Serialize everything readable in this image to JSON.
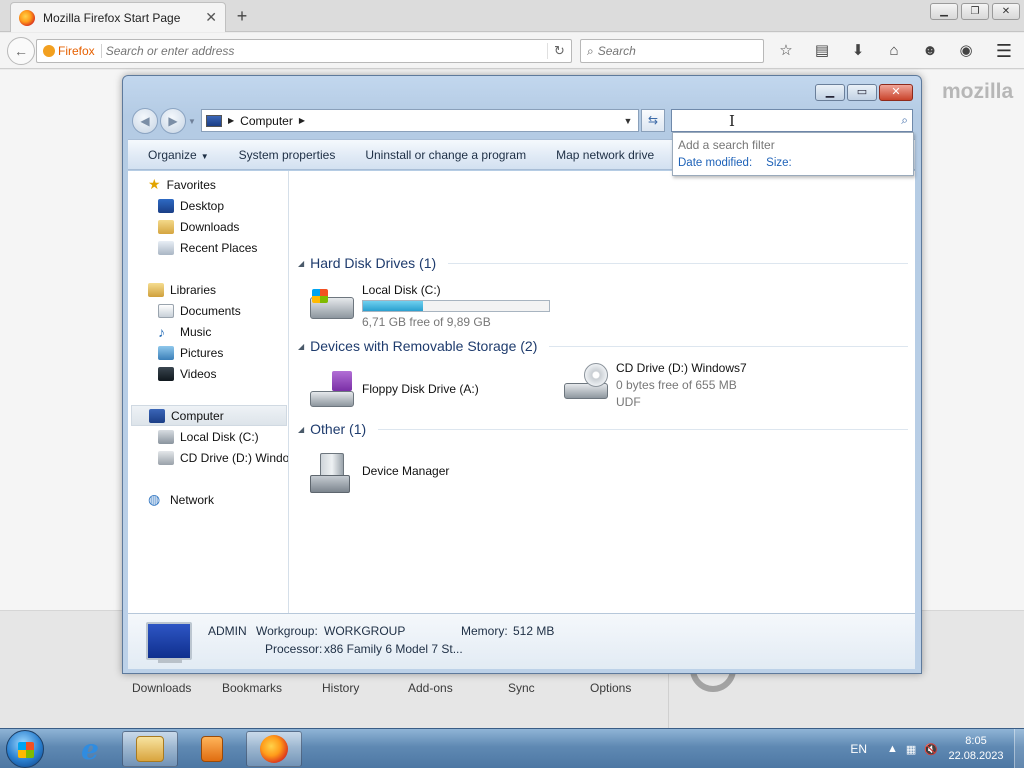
{
  "firefox": {
    "tab_title": "Mozilla Firefox Start Page",
    "tab_close": "✕",
    "new_tab": "+",
    "url_identity": "Firefox",
    "url_placeholder": "Search or enter address",
    "search_placeholder": "Search",
    "wordmark": "mozilla",
    "launcher": [
      "Downloads",
      "Bookmarks",
      "History",
      "Add-ons",
      "Sync",
      "Options"
    ]
  },
  "explorer": {
    "breadcrumb": "Computer",
    "search_value": "",
    "search_hint": "Add a search filter",
    "search_filters": [
      "Date modified:",
      "Size:"
    ],
    "commands": [
      "Organize",
      "System properties",
      "Uninstall or change a program",
      "Map network drive"
    ],
    "nav": {
      "favorites": "Favorites",
      "favorites_items": [
        "Desktop",
        "Downloads",
        "Recent Places"
      ],
      "libraries": "Libraries",
      "libraries_items": [
        "Documents",
        "Music",
        "Pictures",
        "Videos"
      ],
      "computer": "Computer",
      "computer_items": [
        "Local Disk (C:)",
        "CD Drive (D:) Windo"
      ],
      "network": "Network"
    },
    "groups": {
      "hdd": {
        "title": "Hard Disk Drives (1)",
        "items": [
          {
            "name": "Local Disk (C:)",
            "info": "6,71 GB free of 9,89 GB",
            "used_fraction": 0.32
          }
        ]
      },
      "removable": {
        "title": "Devices with Removable Storage (2)",
        "items": [
          {
            "name": "Floppy Disk Drive (A:)"
          },
          {
            "name": "CD Drive (D:) Windows7",
            "info": "0 bytes free of 655 MB",
            "fs": "UDF"
          }
        ]
      },
      "other": {
        "title": "Other (1)",
        "items": [
          {
            "name": "Device Manager"
          }
        ]
      }
    },
    "details": {
      "computer_name": "ADMIN",
      "workgroup_label": "Workgroup:",
      "workgroup": "WORKGROUP",
      "memory_label": "Memory:",
      "memory": "512 MB",
      "processor_label": "Processor:",
      "processor": "x86 Family 6 Model 7 St..."
    }
  },
  "taskbar": {
    "language": "EN",
    "time": "8:05",
    "date": "22.08.2023"
  }
}
